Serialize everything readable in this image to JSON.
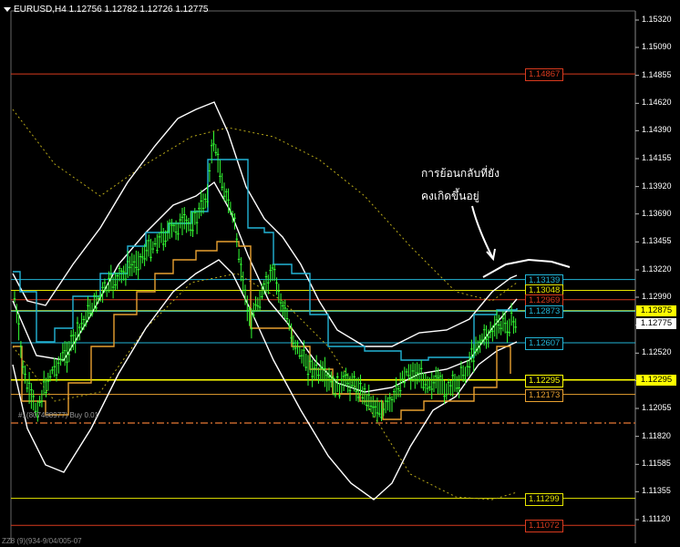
{
  "window": {
    "title": "EURUSD,H4  1.12756 1.12782 1.12726 1.12775"
  },
  "price_axis": {
    "labels": [
      "1.15320",
      "1.15090",
      "1.14855",
      "1.14620",
      "1.14390",
      "1.14155",
      "1.13920",
      "1.13690",
      "1.13455",
      "1.13220",
      "1.12990",
      "1.12755",
      "1.12520",
      "1.12290",
      "1.12055",
      "1.11820",
      "1.11585",
      "1.11355",
      "1.11120"
    ]
  },
  "current_price": {
    "label": "1.12775",
    "value": 1.12775
  },
  "horizontal_lines": [
    {
      "label": "1.14867",
      "value": 1.14867,
      "color": "#d83a1e"
    },
    {
      "label": "1.13139",
      "value": 1.13139,
      "color": "#22b4d6"
    },
    {
      "label": "1.13048",
      "value": 1.13048,
      "color": "#e6e600"
    },
    {
      "label": "1.12969",
      "value": 1.12969,
      "color": "#d83a1e"
    },
    {
      "label": "1.12875",
      "value": 1.12875,
      "color": "#ffff00",
      "axis_tag": true
    },
    {
      "label": "1.12873",
      "value": 1.12873,
      "color": "#22b4d6"
    },
    {
      "label": "1.12607",
      "value": 1.12607,
      "color": "#22b4d6"
    },
    {
      "label": "1.12295",
      "value": 1.12295,
      "color": "#ffff00",
      "axis_tag": true
    },
    {
      "label": "1.12173",
      "value": 1.12173,
      "color": "#e8a030"
    },
    {
      "label": "1.11299",
      "value": 1.11299,
      "color": "#e6e600"
    },
    {
      "label": "1.11072",
      "value": 1.11072,
      "color": "#d83a1e"
    }
  ],
  "annotation": {
    "line1": "การย้อนกลับที่ยัง",
    "line2": "คงเกิดขึ้นอยู่"
  },
  "indicator_text": "#1(807488977) Buy 0.01",
  "footer_text": "ZZ8 (9)(934-9/04/005-07",
  "colors": {
    "background": "#000000",
    "candles": "#33ff33",
    "bollinger": "#ffffff",
    "cyan_line": "#22b4d6",
    "orange_line": "#e8a030",
    "dotted_yellow": "#b8a818"
  }
}
